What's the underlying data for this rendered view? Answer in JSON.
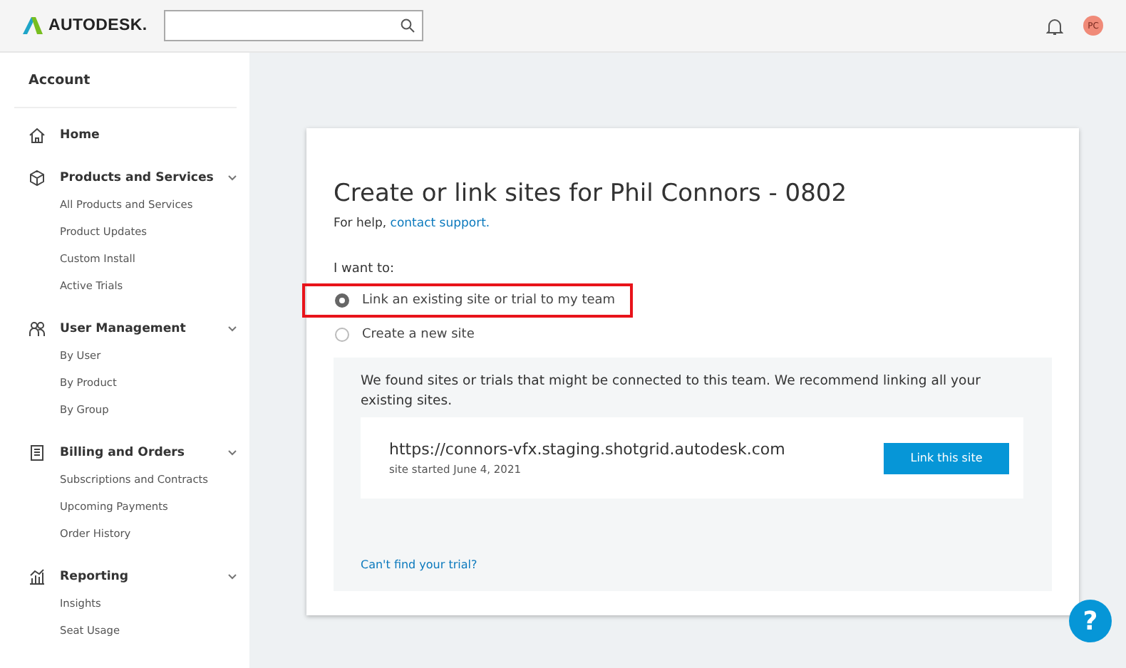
{
  "header": {
    "brand": "AUTODESK.",
    "avatar": "PC"
  },
  "sidebar": {
    "title": "Account",
    "sections": [
      {
        "label": "Home"
      },
      {
        "label": "Products and Services",
        "items": [
          "All Products and Services",
          "Product Updates",
          "Custom Install",
          "Active Trials"
        ]
      },
      {
        "label": "User Management",
        "items": [
          "By User",
          "By Product",
          "By Group"
        ]
      },
      {
        "label": "Billing and Orders",
        "items": [
          "Subscriptions and Contracts",
          "Upcoming Payments",
          "Order History"
        ]
      },
      {
        "label": "Reporting",
        "items": [
          "Insights",
          "Seat Usage"
        ]
      }
    ]
  },
  "card": {
    "title": "Create or link sites for Phil Connors - 0802",
    "help_prefix": "For help, ",
    "help_link": "contact support.",
    "prompt": "I want to:",
    "options": [
      {
        "label": "Link an existing site or trial to my team",
        "selected": true,
        "highlighted": true
      },
      {
        "label": "Create a new site",
        "selected": false,
        "highlighted": false
      }
    ],
    "panel": {
      "message": "We found sites or trials that might be connected to this team. We recommend linking all your existing sites.",
      "sites": [
        {
          "url": "https://connors-vfx.staging.shotgrid.autodesk.com",
          "started": "site started June 4, 2021",
          "button": "Link this site"
        }
      ],
      "footer_link": "Can't find your trial?"
    }
  },
  "help_button": "?"
}
